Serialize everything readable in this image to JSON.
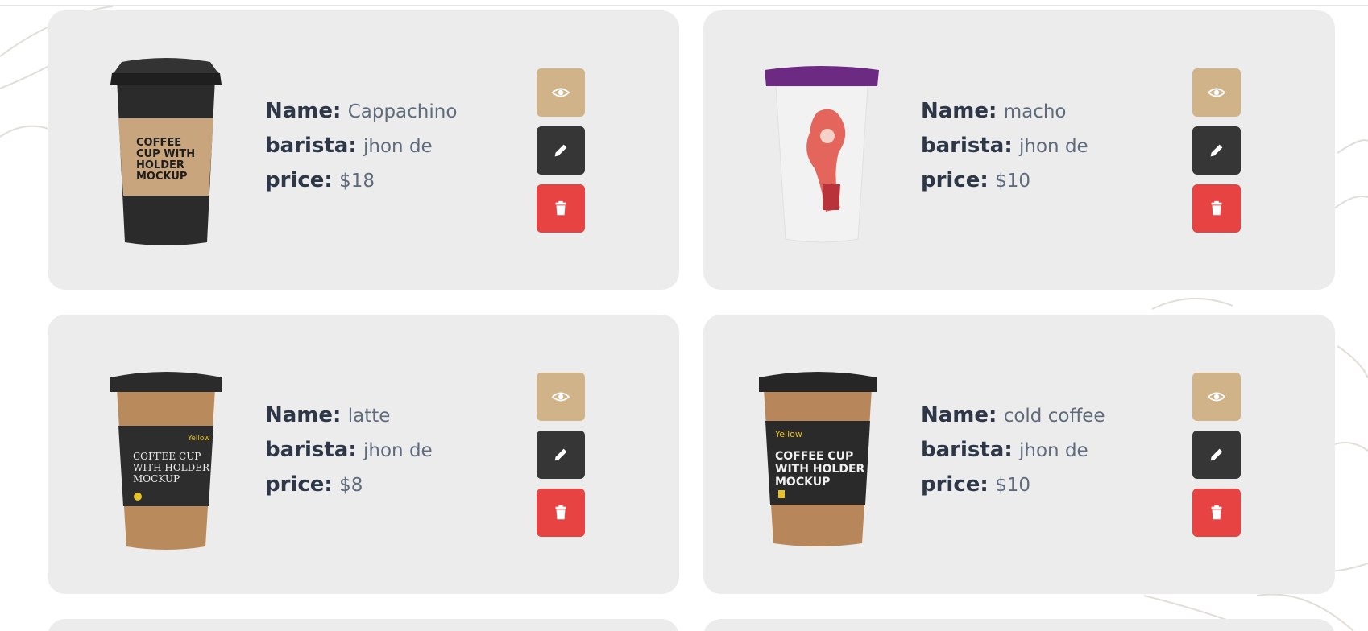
{
  "labels": {
    "name": "Name:",
    "barista": "barista:",
    "price": "price:"
  },
  "colors": {
    "view_button": "#d1b38a",
    "edit_button": "#363636",
    "delete_button": "#e84343",
    "card_background": "#ececec"
  },
  "icons": {
    "view": "eye-icon",
    "edit": "pencil-icon",
    "delete": "trash-icon"
  },
  "products": [
    {
      "name": "Cappachino",
      "barista": "jhon de",
      "price": "$18",
      "cup": "black-cup-with-kraft-sleeve",
      "sleeve_text": "COFFEE CUP WITH HOLDER MOCKUP"
    },
    {
      "name": "macho",
      "barista": "jhon de",
      "price": "$10",
      "cup": "white-cup-purple-lid",
      "sleeve_text": ""
    },
    {
      "name": "latte",
      "barista": "jhon de",
      "price": "$8",
      "cup": "kraft-cup-black-band",
      "sleeve_text": "COFFEE CUP WITH HOLDER MOCKUP",
      "brand_text": "Yellow"
    },
    {
      "name": "cold coffee",
      "barista": "jhon de",
      "price": "$10",
      "cup": "patterned-cup-black-band",
      "sleeve_text": "COFFEE CUP WITH HOLDER MOCKUP",
      "brand_text": "Yellow"
    }
  ]
}
